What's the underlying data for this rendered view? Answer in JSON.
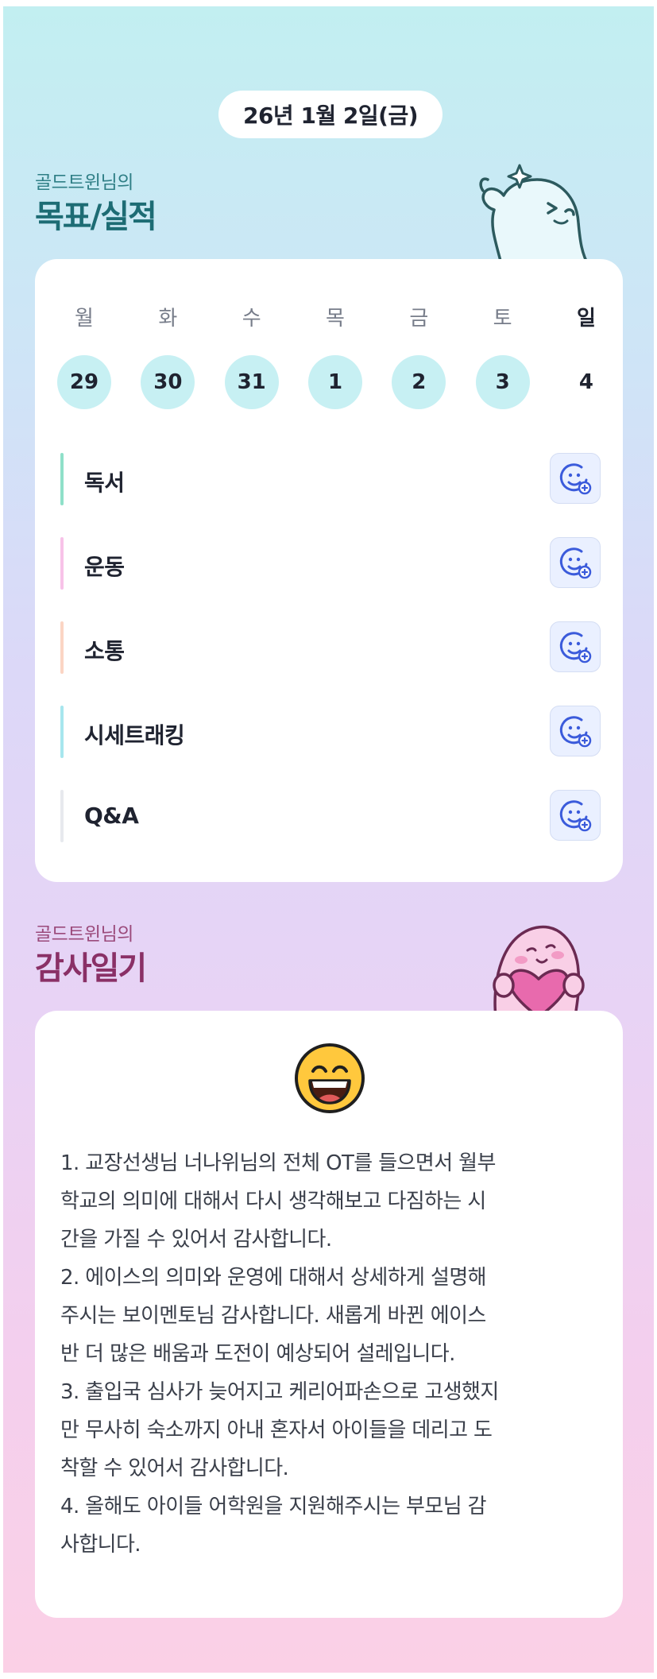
{
  "header": {
    "date_label": "26년 1월 2일(금)"
  },
  "goals_section": {
    "subtitle": "골드트윈님의",
    "title": "목표/실적",
    "week": {
      "days": [
        {
          "day": "월",
          "date": "29",
          "highlighted": true
        },
        {
          "day": "화",
          "date": "30",
          "highlighted": true
        },
        {
          "day": "수",
          "date": "31",
          "highlighted": true
        },
        {
          "day": "목",
          "date": "1",
          "highlighted": true
        },
        {
          "day": "금",
          "date": "2",
          "highlighted": true
        },
        {
          "day": "토",
          "date": "3",
          "highlighted": true
        },
        {
          "day": "일",
          "date": "4",
          "highlighted": false
        }
      ]
    },
    "items": [
      {
        "label": "독서",
        "accent": "#8fe0c9",
        "icon": "add-emotion-icon"
      },
      {
        "label": "운동",
        "accent": "#f7c2e8",
        "icon": "add-emotion-icon"
      },
      {
        "label": "소통",
        "accent": "#fbd5c4",
        "icon": "add-emotion-icon"
      },
      {
        "label": "시세트래킹",
        "accent": "#a7e6ee",
        "icon": "add-emotion-icon"
      },
      {
        "label": "Q&A",
        "accent": "#e7e9ee",
        "icon": "add-emotion-icon"
      }
    ]
  },
  "thanks_section": {
    "subtitle": "골드트윈님의",
    "title": "감사일기",
    "emoji": "grinning-face-icon",
    "text": "1. 교장선생님 너나위님의 전체 OT를 들으면서 월부\n학교의 의미에 대해서 다시 생각해보고 다짐하는 시\n간을 가질 수 있어서 감사합니다.\n2. 에이스의 의미와 운영에 대해서 상세하게 설명해\n주시는 보이멘토님 감사합니다. 새롭게 바뀐 에이스\n반 더 많은 배움과 도전이 예상되어 설레입니다.\n3. 출입국 심사가 늦어지고 케리어파손으로 고생했지\n만 무사히 숙소까지 아내 혼자서 아이들을 데리고 도\n착할 수 있어서 감사합니다.\n4. 올해도 아이들 어학원을 지원해주시는 부모님 감\n사합니다."
  },
  "colors": {
    "goal_title": "#1d6c74",
    "thanks_title": "#8a3066",
    "date_highlight": "#c7f0f3",
    "icon_blue": "#3b5bdb"
  }
}
